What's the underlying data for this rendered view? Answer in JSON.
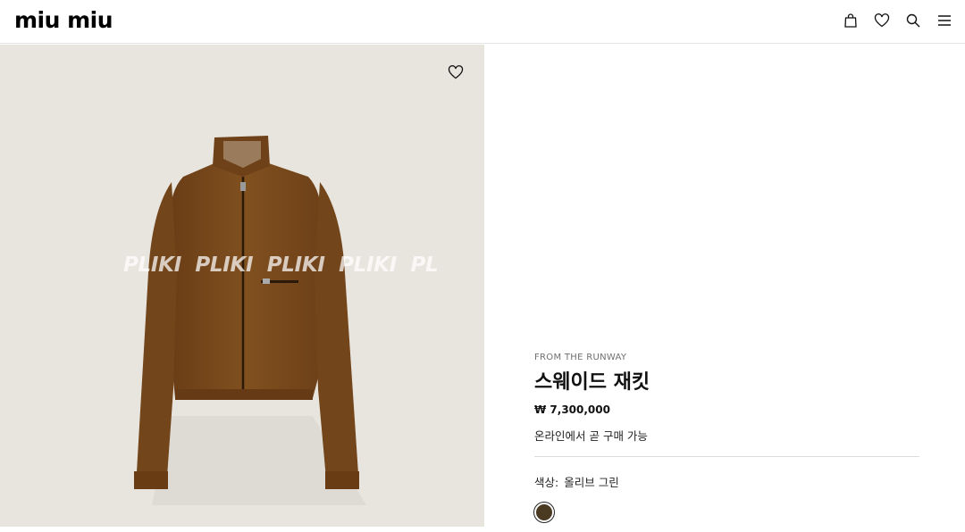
{
  "header": {
    "logo": "miu miu",
    "icons": [
      "bag-icon",
      "heart-icon",
      "search-icon",
      "menu-icon"
    ]
  },
  "media": {
    "watermark": "PLIKI  PLIKI  PLIKI  PLIKI  PL",
    "image_alt": "jacket-image"
  },
  "product": {
    "eyebrow": "FROM THE RUNWAY",
    "title": "스웨이드 재킷",
    "price": "₩ 7,300,000",
    "availability": "온라인에서 곧 구매 가능",
    "color_label": "색상:",
    "color_value": "올리브 그린",
    "swatch_color": "#4a3a22"
  },
  "colors": {
    "media_bg": "#e8e4de",
    "jacket": "#7a4a1e"
  }
}
